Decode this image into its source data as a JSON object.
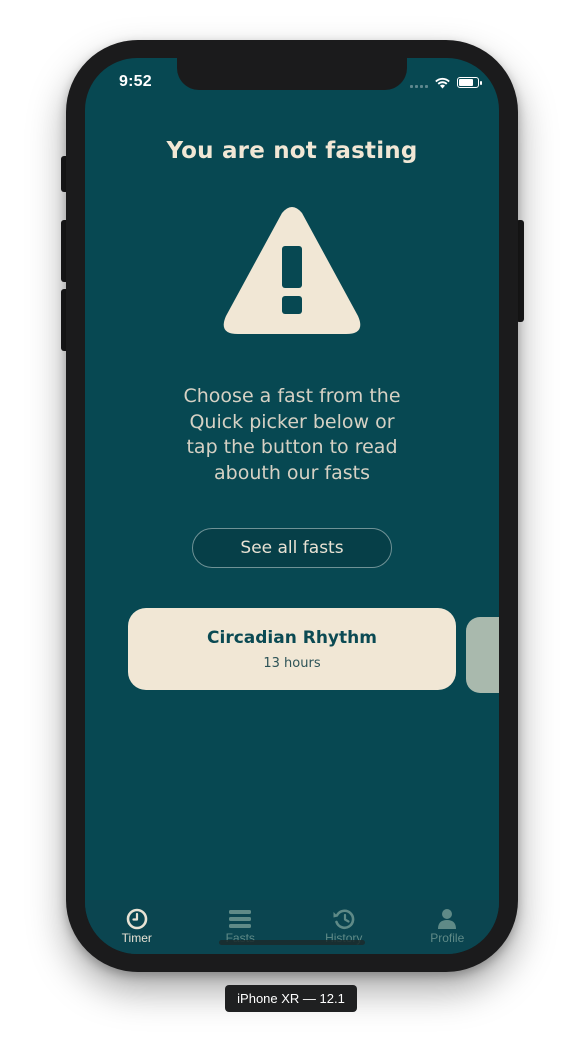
{
  "status_bar": {
    "time": "9:52",
    "icons": [
      "signal-icon",
      "wifi-icon",
      "battery-icon"
    ],
    "battery_level": 0.85
  },
  "main": {
    "title": "You are not fasting",
    "warning_icon": "warning-triangle-icon",
    "message": "Choose a fast from the\nQuick picker below or\ntap the button to read\nabouth our fasts",
    "see_all_label": "See all fasts"
  },
  "fast_picker": {
    "items": [
      {
        "name": "Circadian Rhythm",
        "duration": "13 hours"
      }
    ]
  },
  "tabbar": {
    "tabs": [
      {
        "label": "Timer",
        "icon": "clock-icon",
        "active": true
      },
      {
        "label": "Fasts",
        "icon": "list-icon",
        "active": false
      },
      {
        "label": "History",
        "icon": "history-icon",
        "active": false
      },
      {
        "label": "Profile",
        "icon": "person-icon",
        "active": false
      }
    ]
  },
  "device_label": "iPhone XR — 12.1",
  "colors": {
    "background": "#074852",
    "cream": "#F1E7D5",
    "tab_active": "#E8E2D4",
    "tab_inactive": "#5F8A87"
  }
}
